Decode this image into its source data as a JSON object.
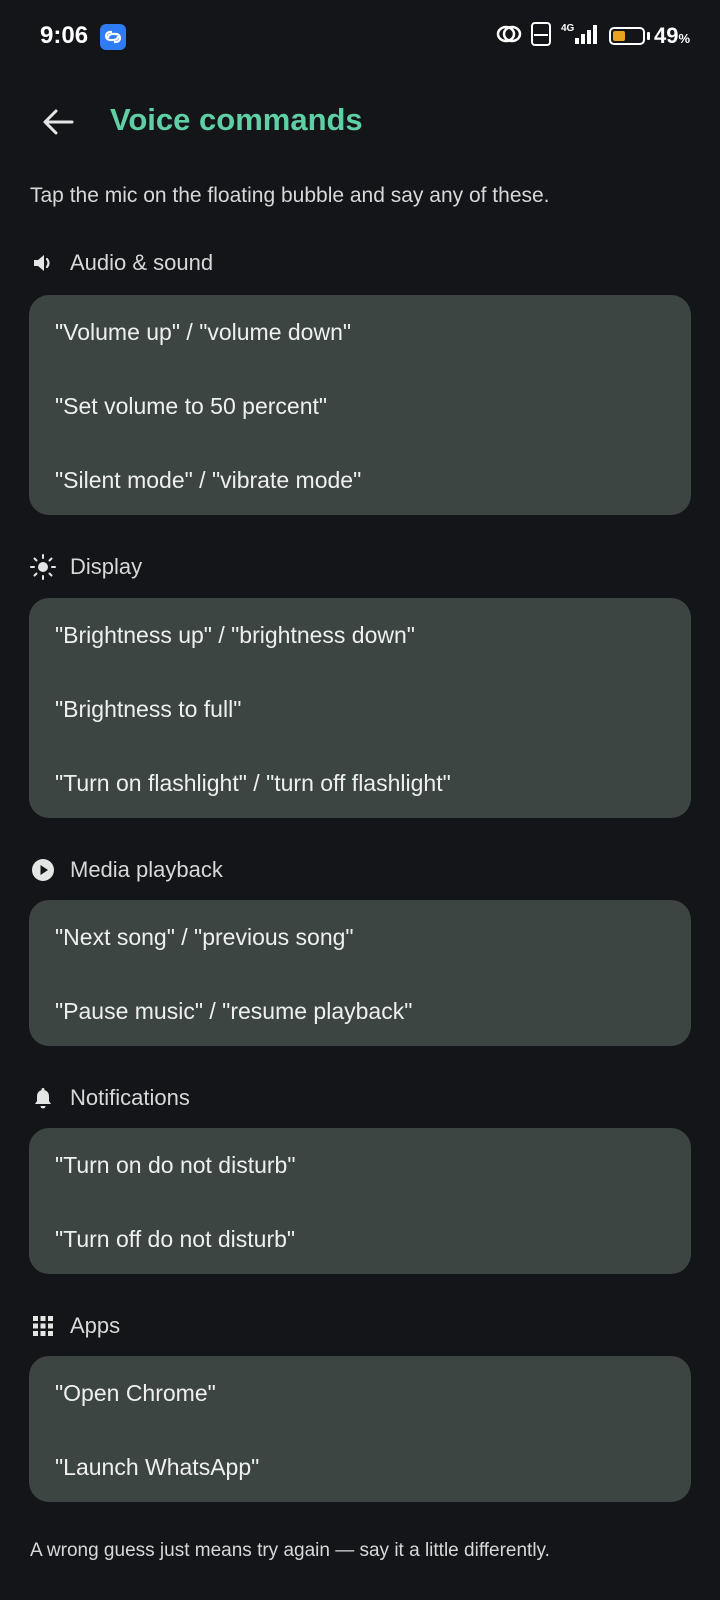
{
  "status_bar": {
    "time": "9:06",
    "network": "4G",
    "volte": "Vo LTE",
    "battery_percent": "49",
    "battery_unit": "%",
    "battery_level": 0.49,
    "battery_color": "#e8a320"
  },
  "header": {
    "back_icon": "arrow-left-icon",
    "title": "Voice commands"
  },
  "intro": "Tap the mic on the floating bubble and say any of these.",
  "sections": [
    {
      "icon": "speaker-icon",
      "label": "Audio & sound",
      "commands": [
        "\"Volume up\" / \"volume down\"",
        "\"Set volume to 50 percent\"",
        "\"Silent mode\" / \"vibrate mode\""
      ]
    },
    {
      "icon": "brightness-icon",
      "label": "Display",
      "commands": [
        "\"Brightness up\" / \"brightness down\"",
        "\"Brightness to full\"",
        "\"Turn on flashlight\" / \"turn off flashlight\""
      ]
    },
    {
      "icon": "play-circle-icon",
      "label": "Media playback",
      "commands": [
        "\"Next song\" / \"previous song\"",
        "\"Pause music\" / \"resume playback\""
      ]
    },
    {
      "icon": "bell-icon",
      "label": "Notifications",
      "commands": [
        "\"Turn on do not disturb\"",
        "\"Turn off do not disturb\""
      ]
    },
    {
      "icon": "apps-grid-icon",
      "label": "Apps",
      "commands": [
        "\"Open Chrome\"",
        "\"Launch WhatsApp\""
      ]
    }
  ],
  "footer": "A wrong guess just means try again — say it a little differently.",
  "colors": {
    "background": "#141519",
    "accent": "#5fd0a6",
    "card": "#3d4543"
  }
}
